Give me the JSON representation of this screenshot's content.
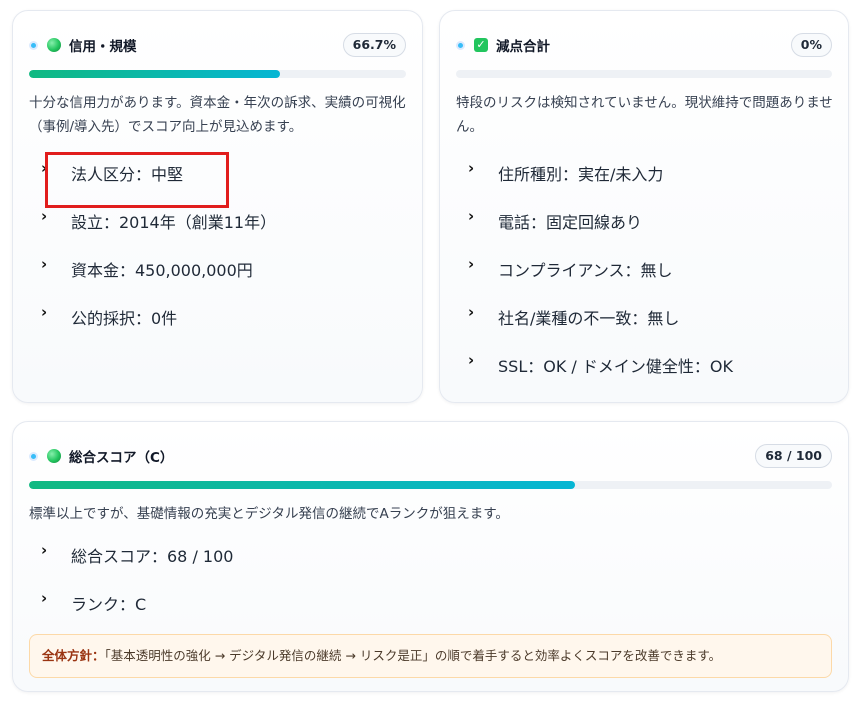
{
  "credit_card": {
    "title": "信用・規模",
    "badge": "66.7%",
    "progress": 0.667,
    "description": "十分な信用力があります。資本金・年次の訴求、実績の可視化（事例/導入先）でスコア向上が見込めます。",
    "items": [
      "法人区分：中堅",
      "設立：2014年（創業11年）",
      "資本金：450,000,000円",
      "公的採択：0件"
    ]
  },
  "deduction_card": {
    "title": "減点合計",
    "badge": "0%",
    "progress": 0,
    "description": "特段のリスクは検知されていません。現状維持で問題ありません。",
    "items": [
      "住所種別：実在/未入力",
      "電話：固定回線あり",
      "コンプライアンス：無し",
      "社名/業種の不一致：無し",
      "SSL：OK / ドメイン健全性：OK"
    ]
  },
  "total_card": {
    "title": "総合スコア（C）",
    "badge": "68 / 100",
    "progress": 0.68,
    "description": "標準以上ですが、基礎情報の充実とデジタル発信の継続でAランクが狙えます。",
    "items": [
      "総合スコア：68 / 100",
      "ランク：C"
    ],
    "policy_label": "全体方針：",
    "policy_text": "「基本透明性の強化 → デジタル発信の継続 → リスク是正」の順で着手すると効率よくスコアを改善できます。"
  },
  "colors": {
    "accent_gradient_start": "#10b981",
    "accent_gradient_end": "#06b6d4",
    "highlight": "#e11d1d",
    "policy_bg": "#fff7ed"
  },
  "icons": {
    "status_dot": "status-dot-icon",
    "credit": "green-circle-icon",
    "deduction": "check-box-icon",
    "total": "green-circle-icon",
    "list_marker": "chevron-right-icon"
  }
}
